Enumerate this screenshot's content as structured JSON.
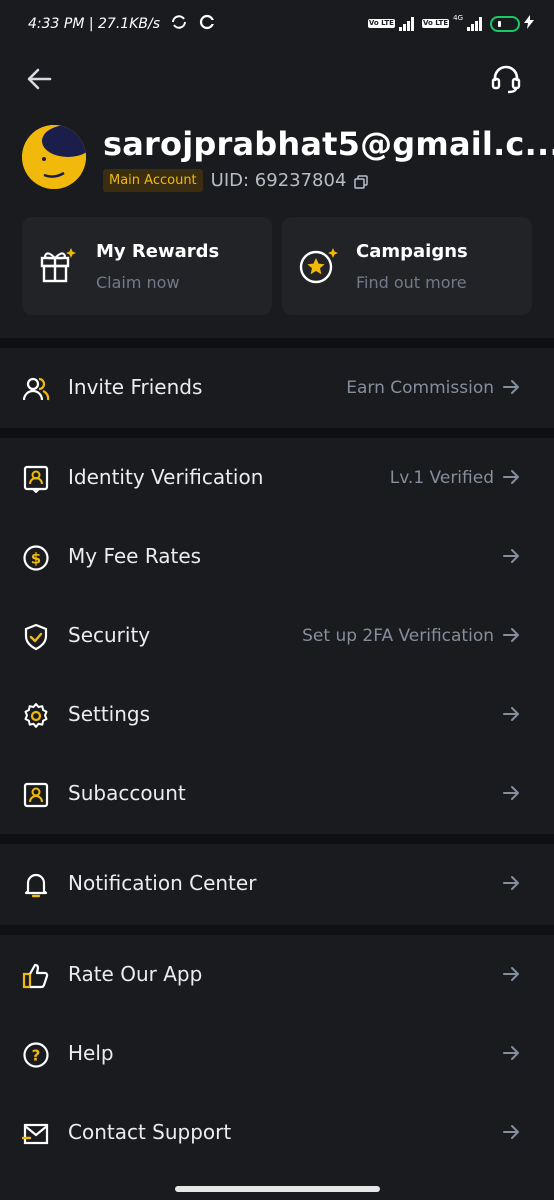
{
  "status_bar": {
    "time_speed": "4:33 PM | 27.1KB/s",
    "volte_1": "Vo LTE",
    "volte_2": "Vo LTE",
    "net_type": "4G",
    "battery_level": "1"
  },
  "header": {
    "back_icon": "arrow-left-icon",
    "support_icon": "headset-icon"
  },
  "profile": {
    "email": "sarojprabhat5@gmail.c...",
    "badge": "Main Account",
    "uid": "UID: 69237804"
  },
  "cards": [
    {
      "title": "My Rewards",
      "subtitle": "Claim now",
      "icon": "gift-icon"
    },
    {
      "title": "Campaigns",
      "subtitle": "Find out more",
      "icon": "star-badge-icon"
    }
  ],
  "menu": {
    "invite": {
      "label": "Invite Friends",
      "right": "Earn Commission"
    },
    "identity": {
      "label": "Identity Verification",
      "right": "Lv.1 Verified"
    },
    "fees": {
      "label": "My Fee Rates",
      "right": ""
    },
    "security": {
      "label": "Security",
      "right": "Set up 2FA Verification"
    },
    "settings": {
      "label": "Settings",
      "right": ""
    },
    "subaccount": {
      "label": "Subaccount",
      "right": ""
    },
    "notifications": {
      "label": "Notification Center",
      "right": ""
    },
    "rate": {
      "label": "Rate Our App",
      "right": ""
    },
    "help": {
      "label": "Help",
      "right": ""
    },
    "contact": {
      "label": "Contact Support",
      "right": ""
    }
  },
  "colors": {
    "accent": "#f0b90b",
    "background": "#1a1b1f",
    "card": "#222327",
    "divider": "#0f1012",
    "muted_text": "#848e9c"
  }
}
